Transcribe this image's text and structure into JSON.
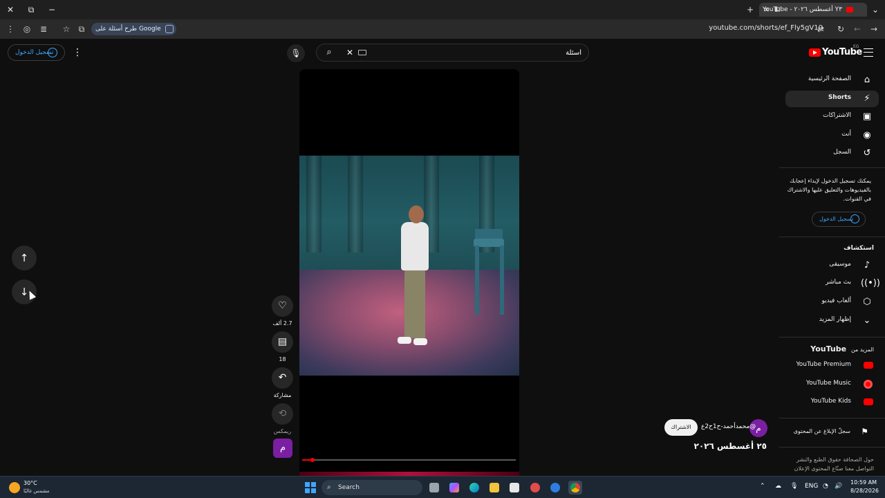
{
  "browser": {
    "tab_title": "Y٣ أغسطس ٢٠٢٦ - YouTube",
    "tab_close": "×",
    "url": "youtube.com/shorts/ef_Fly5gV10",
    "google_chip": "طرح أسئلة على Google"
  },
  "topbar": {
    "signin_label": "تسجيل الدخول",
    "search_placeholder": "أسئلة",
    "logo_text": "YouTube",
    "country_code": "EG"
  },
  "sidebar": {
    "nav": [
      {
        "label": "الصفحة الرئيسية",
        "icon": "home-icon"
      },
      {
        "label": "Shorts",
        "icon": "shorts-icon"
      },
      {
        "label": "الاشتراكات",
        "icon": "subscriptions-icon"
      },
      {
        "label": "أنت",
        "icon": "you-icon"
      },
      {
        "label": "السجل",
        "icon": "history-icon"
      }
    ],
    "signin_note": "يمكنك تسجيل الدخول لإبداء إعجابك بالفيديوهات والتعليق عليها والاشتراك في القنوات.",
    "signin_label": "تسجيل الدخول",
    "explore_heading": "استكشاف",
    "explore": [
      {
        "label": "موسيقى",
        "icon": "music-note-icon"
      },
      {
        "label": "بث مباشر",
        "icon": "live-icon"
      },
      {
        "label": "ألعاب فيديو",
        "icon": "gaming-icon"
      },
      {
        "label": "إظهار المزيد",
        "icon": "chevron-down-icon"
      }
    ],
    "more_heading_ar": "المزيد من",
    "more_heading_brand": "YouTube",
    "more": [
      {
        "label": "YouTube Premium"
      },
      {
        "label": "YouTube Music"
      },
      {
        "label": "YouTube Kids"
      }
    ],
    "report_label": "سجلّ الإبلاغ عن المحتوى",
    "footer": "حول  الصحافة  حقوق الطبع والنشر  التواصل معنا  صنّاع المحتوى  الإعلان"
  },
  "actions": {
    "like_count": "2.7 ألف",
    "comment_count": "18",
    "share_label": "مشاركة",
    "remix_label": "ريمكس",
    "avatar_letter": "م"
  },
  "video": {
    "progress": 0.05
  },
  "channel": {
    "avatar_letter": "م",
    "handle": "@محمدأحمد-ح1ح2ع",
    "subscribe_label": "الاشتراك",
    "title": "٢٥ أغسطس ٢٠٢٦"
  },
  "taskbar": {
    "temp": "30°C",
    "weather": "مشمس غالبًا",
    "search_label": "Search",
    "lang": "ENG",
    "time": "10:59 AM",
    "date": "8/28/2026"
  },
  "colors": {
    "accent": "#3ea6ff",
    "brand_red": "#ff0000",
    "background": "#0f0f0f",
    "channel_purple": "#7b1fa2"
  }
}
